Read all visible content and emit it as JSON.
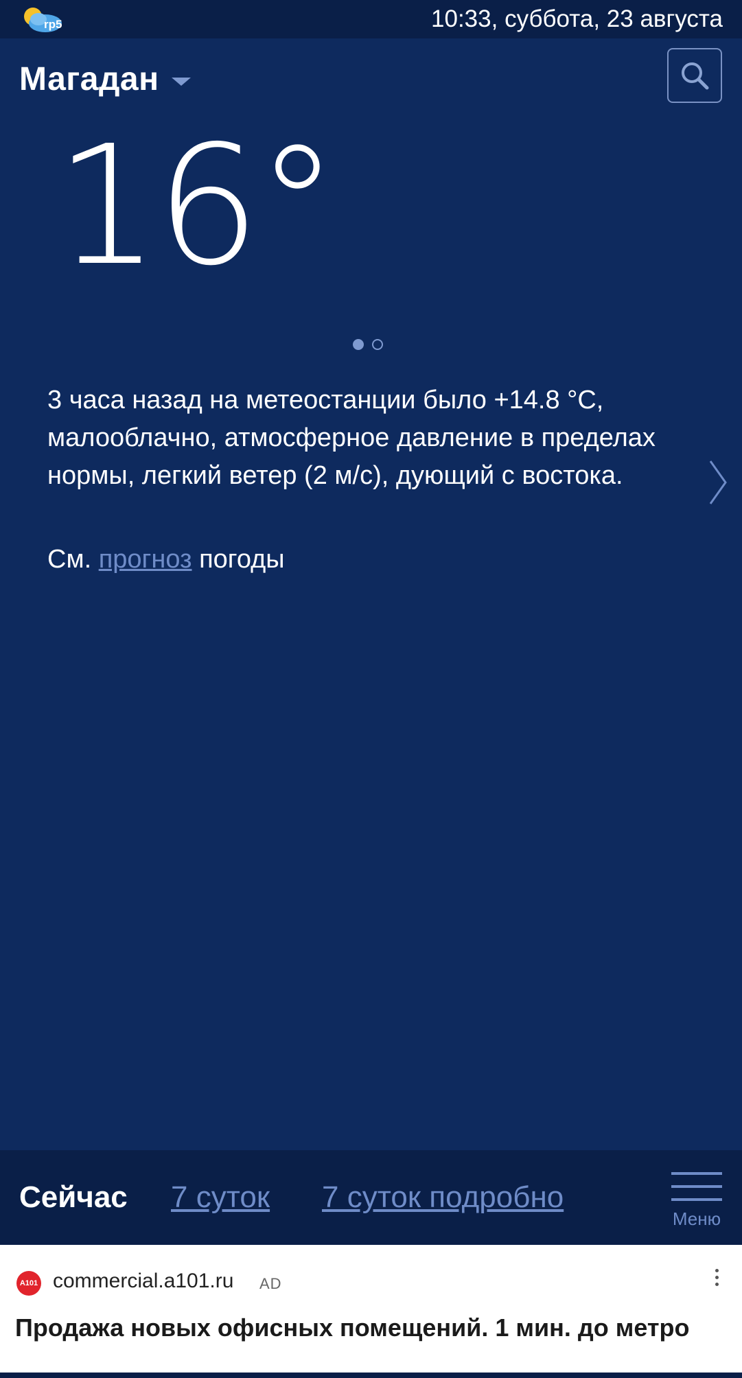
{
  "status_bar": {
    "app_logo_text": "rp5",
    "datetime": "10:33, суббота, 23 августа"
  },
  "header": {
    "city": "Магадан",
    "search_icon": "search-icon"
  },
  "weather": {
    "temperature": "16°",
    "pager": {
      "total": 2,
      "active": 1
    },
    "description": "3 часа назад на метеостанции было +14.8 °C, малооблачно, атмосферное давление в пределах нормы, легкий ветер (2 м/с), дующий с востока.",
    "forecast_prefix": "См.",
    "forecast_link": "прогноз",
    "forecast_suffix": "погоды"
  },
  "bottom_nav": {
    "tabs": [
      {
        "label": "Сейчас",
        "active": true
      },
      {
        "label": "7 суток",
        "active": false
      },
      {
        "label": "7 суток подробно",
        "active": false
      }
    ],
    "menu_label": "Меню"
  },
  "ad": {
    "logo_text": "A101",
    "domain": "commercial.a101.ru",
    "badge": "AD",
    "title": "Продажа новых офисных помещений. 1 мин. до метро"
  },
  "colors": {
    "background": "#0e2a5e",
    "bar": "#0a1f48",
    "link": "#6f8cc8",
    "ad_logo": "#e1242c"
  }
}
